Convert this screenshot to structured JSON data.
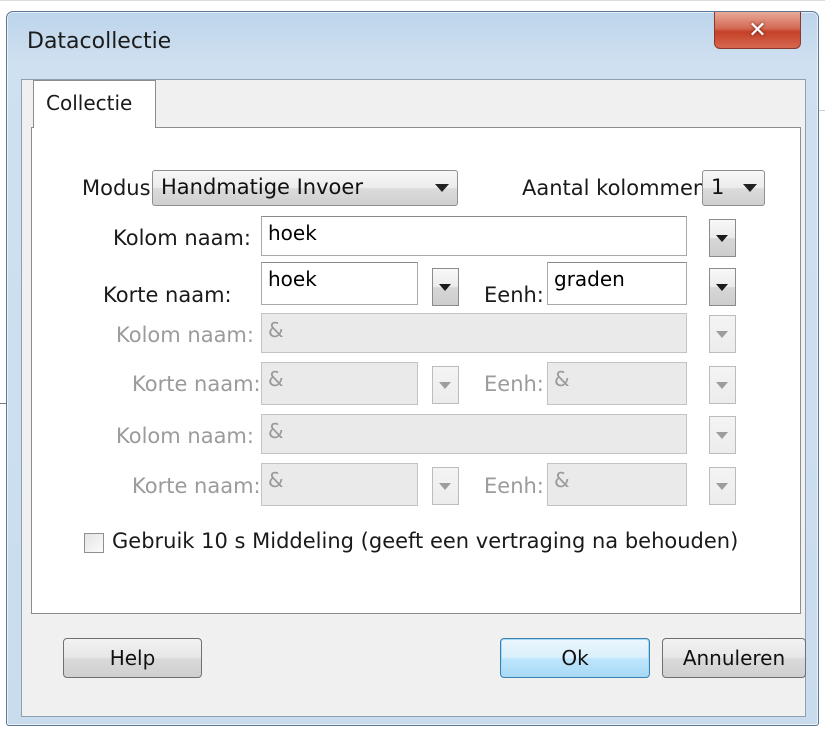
{
  "window": {
    "title": "Datacollectie",
    "close_glyph": "✕"
  },
  "tabs": [
    {
      "label": "Collectie"
    }
  ],
  "modus": {
    "label": "Modus",
    "value": "Handmatige Invoer"
  },
  "aantal": {
    "label": "Aantal kolommen:",
    "value": "1"
  },
  "columns": [
    {
      "kolom_label": "Kolom naam:",
      "kolom_value": "hoek",
      "korte_label": "Korte naam:",
      "korte_value": "hoek",
      "eenh_label": "Eenh:",
      "eenh_value": "graden",
      "enabled": true
    },
    {
      "kolom_label": "Kolom naam:",
      "kolom_value": "&",
      "korte_label": "Korte naam:",
      "korte_value": "&",
      "eenh_label": "Eenh:",
      "eenh_value": "&",
      "enabled": false
    },
    {
      "kolom_label": "Kolom naam:",
      "kolom_value": "&",
      "korte_label": "Korte naam:",
      "korte_value": "&",
      "eenh_label": "Eenh:",
      "eenh_value": "&",
      "enabled": false
    }
  ],
  "averaging": {
    "label": "Gebruik 10 s Middeling (geeft een vertraging na behouden)",
    "checked": false
  },
  "buttons": {
    "help": "Help",
    "ok": "Ok",
    "cancel": "Annuleren"
  },
  "colors": {
    "close_red": "#c44128",
    "title_blue": "#cfe0f0",
    "disabled_text": "#9b9b9b"
  },
  "icons": {
    "close": "close-icon",
    "dropdown": "chevron-down-icon"
  }
}
